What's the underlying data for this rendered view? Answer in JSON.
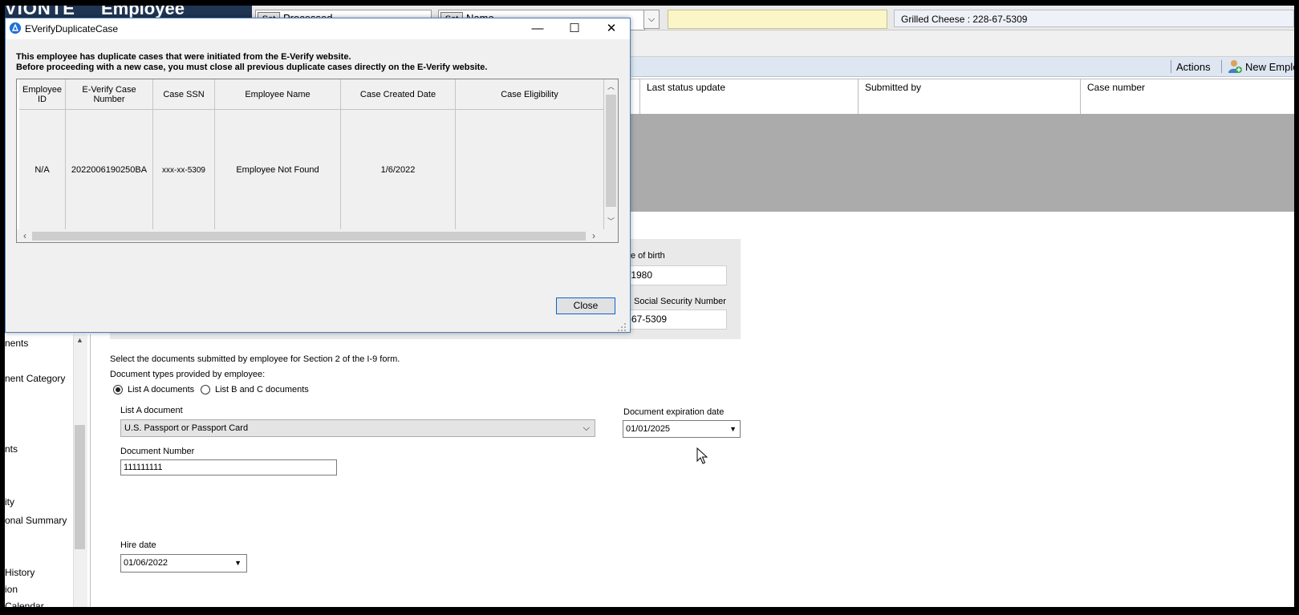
{
  "background": {
    "brand_text_1": "VIONTE",
    "brand_text_2": "Employee",
    "combo1": {
      "button": "Set",
      "value": "Processed"
    },
    "combo2": {
      "button": "Set",
      "value": "Name"
    },
    "employee_field": "Grilled  Cheese : 228-67-5309",
    "actions_label": "Actions",
    "new_employee_label": "New Emplo",
    "grid_columns": [
      "Last status update",
      "Submitted by",
      "Case number"
    ],
    "form": {
      "dob_label": "e of birth",
      "dob_value": "/1980",
      "ssn_label": "Social Security Number",
      "ssn_value": "-67-5309",
      "instruction": "Select the documents submitted by employee for Section 2 of the I-9 form.",
      "doc_types_label": "Document types provided by employee:",
      "radio_list_a": "List A documents",
      "radio_list_bc": "List B and C documents",
      "list_a_label": "List A document",
      "list_a_value": "U.S. Passport or Passport Card",
      "doc_exp_label": "Document expiration date",
      "doc_exp_value": "01/01/2025",
      "doc_number_label": "Document Number",
      "doc_number_value": "111111111",
      "hire_date_label": "Hire date",
      "hire_date_value": "01/06/2022"
    },
    "left_nav": [
      "nents",
      "nent Category",
      "nts",
      "ity",
      "onal Summary",
      "History",
      "ion",
      "Calendar"
    ]
  },
  "dialog": {
    "title": "EVerifyDuplicateCase",
    "message_line1": "This employee has duplicate cases that were initiated from the E-Verify website.",
    "message_line2": "Before proceeding with a new case, you must close all previous duplicate cases directly on the E-Verify website.",
    "columns": [
      "Employee ID",
      "E-Verify Case Number",
      "Case SSN",
      "Employee Name",
      "Case Created Date",
      "Case Eligibility"
    ],
    "rows": [
      [
        "N/A",
        "2022006190250BA",
        "xxx-xx-5309",
        "Employee Not Found",
        "1/6/2022",
        ""
      ]
    ],
    "close_label": "Close",
    "minimize_glyph": "—",
    "maximize_glyph": "☐",
    "close_glyph": "✕"
  }
}
